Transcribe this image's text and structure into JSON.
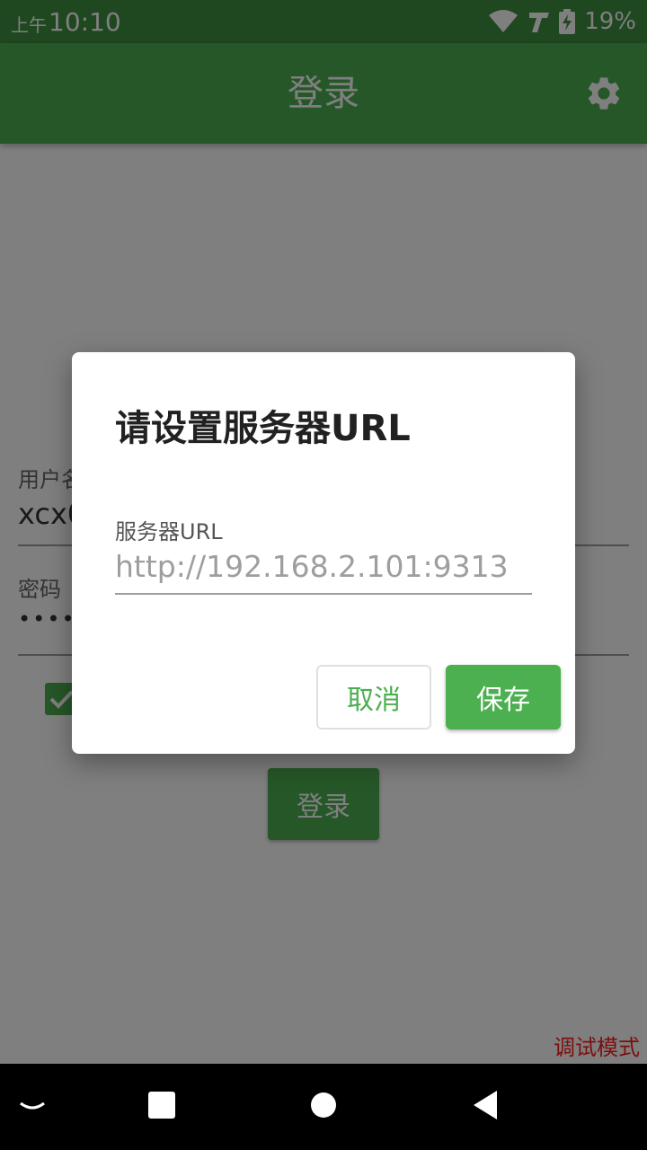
{
  "status_bar": {
    "ampm": "上午",
    "time": "10:10",
    "battery": "19%",
    "icons": [
      "wifi-icon",
      "t-carrier-icon",
      "battery-charging-icon"
    ]
  },
  "app_bar": {
    "title": "登录",
    "settings_icon": "gear-icon",
    "color": "#4caf50"
  },
  "login_form": {
    "username_label": "用户名",
    "username_value": "xcx0",
    "password_label": "密码",
    "password_value": "••••••",
    "remember_checked": true,
    "login_button": "登录",
    "debug_label": "调试模式"
  },
  "dialog": {
    "title": "请设置服务器URL",
    "input_label": "服务器URL",
    "input_value": "http://192.168.2.101:9313",
    "cancel_label": "取消",
    "save_label": "保存"
  },
  "nav_bar": {
    "icons": [
      "chevron-down-icon",
      "recents-icon",
      "home-icon",
      "back-icon"
    ]
  }
}
